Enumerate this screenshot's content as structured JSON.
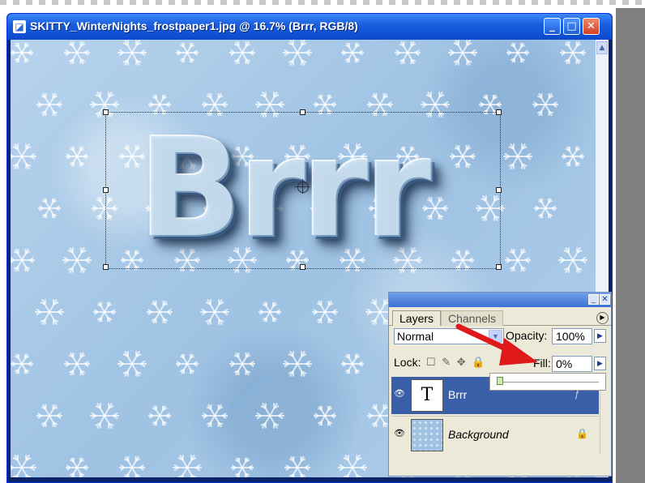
{
  "window": {
    "title": "SKITTY_WinterNights_frostpaper1.jpg @ 16.7% (Brrr, RGB/8)",
    "buttons": {
      "minimize": "_",
      "maximize": "□",
      "close": "✕"
    }
  },
  "canvas": {
    "text_layer_content": "Brrr"
  },
  "layers_panel": {
    "tabs": [
      "Layers",
      "Channels"
    ],
    "blend_mode": "Normal",
    "opacity_label": "Opacity:",
    "opacity_value": "100%",
    "lock_label": "Lock:",
    "lock_icons": "☐ ✎ ✥ 🔒",
    "fill_label": "Fill:",
    "fill_value": "0%",
    "fill_slider_level": 0,
    "layers": [
      {
        "name": "Brrr",
        "type": "text",
        "thumb_glyph": "T",
        "selected": true
      },
      {
        "name": "Background",
        "type": "image",
        "locked": true
      }
    ]
  },
  "colors": {
    "titlebar": "#1a5fe0",
    "selected_layer": "#3a5fa8",
    "arrow": "#e01a1a",
    "canvas_bg": "#a8c8e6"
  },
  "icons": {
    "document": "photoshop-doc-icon",
    "eye": "visibility-eye-icon",
    "lock": "lock-icon",
    "fx": "layer-effects-icon"
  }
}
